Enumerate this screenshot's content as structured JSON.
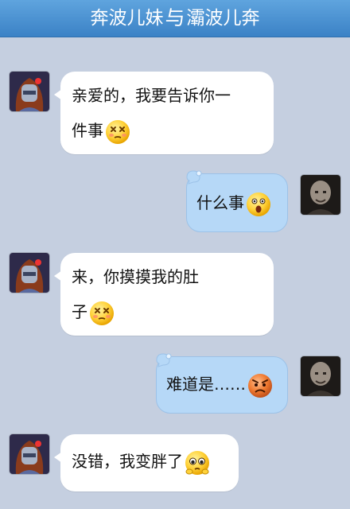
{
  "header": {
    "left_name": "奔波儿妹",
    "separator": "与",
    "right_name": "灞波儿奔"
  },
  "messages": [
    {
      "side": "left",
      "lines": [
        "亲爱的，我要告诉你一",
        "件事"
      ],
      "emoji": "dizzy-face-emoji"
    },
    {
      "side": "right",
      "lines": [
        "什么事"
      ],
      "emoji": "surprised-face-emoji"
    },
    {
      "side": "left",
      "lines": [
        "来，你摸摸我的肚",
        "子"
      ],
      "emoji": "dizzy-face-emoji"
    },
    {
      "side": "right",
      "lines": [
        "难道是……"
      ],
      "emoji": "angry-face-emoji"
    },
    {
      "side": "left",
      "lines": [
        "没错，我变胖了"
      ],
      "emoji": "pleading-face-emoji"
    }
  ],
  "colors": {
    "background": "#c5cfe0",
    "title_bar": "#4a8fd2",
    "left_bubble": "#ffffff",
    "right_bubble": "#b6d8f7"
  }
}
